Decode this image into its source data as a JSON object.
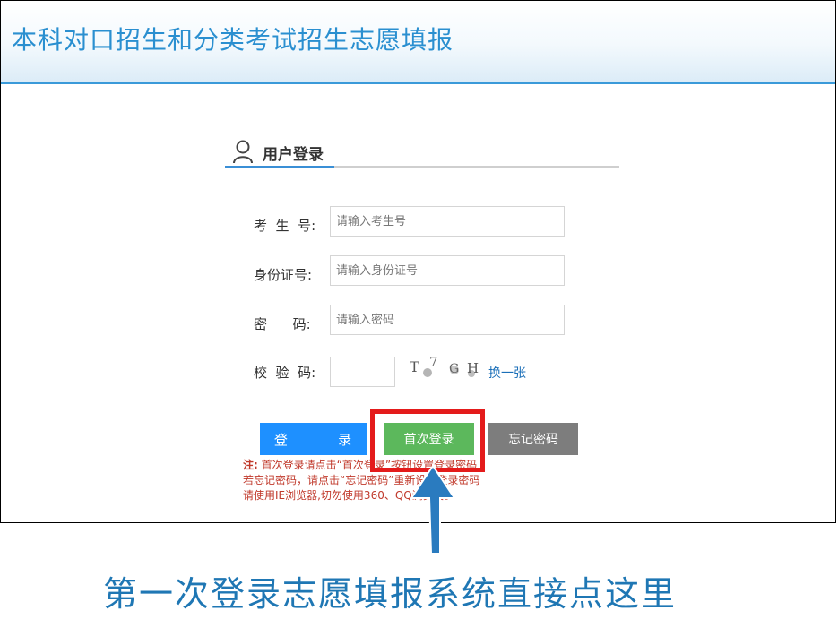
{
  "header": {
    "title": "本科对口招生和分类考试招生志愿填报"
  },
  "login_section": {
    "title": "用户登录",
    "icon": "user-icon"
  },
  "form": {
    "exam_number": {
      "label": "考  生  号:",
      "placeholder": "请输入考生号"
    },
    "id_number": {
      "label": "身份证号:",
      "placeholder": "请输入身份证号"
    },
    "password": {
      "label": "密      码:",
      "placeholder": "请输入密码"
    },
    "captcha": {
      "label": "校  验  码:",
      "code": "T7GH",
      "refresh_label": "换一张"
    }
  },
  "buttons": {
    "login": "登        录",
    "first_login": "首次登录",
    "forgot_password": "忘记密码"
  },
  "notes": {
    "prefix": "注:",
    "line1": "首次登录请点击“首次登录”按钮设置登录密码",
    "line2": "若忘记密码，请点击“忘记密码”重新设置登录密码",
    "line3": "请使用IE浏览器,切勿使用360、QQ浏览器。"
  },
  "annotation": {
    "caption": "第一次登录志愿填报系统直接点这里",
    "highlight_color": "#e41b1b",
    "arrow_color": "#2a7bbf"
  },
  "colors": {
    "header_title": "#2a8fd0",
    "login_button": "#1e90ff",
    "first_login_button": "#5cb85c",
    "forgot_button": "#7d7d7d"
  }
}
